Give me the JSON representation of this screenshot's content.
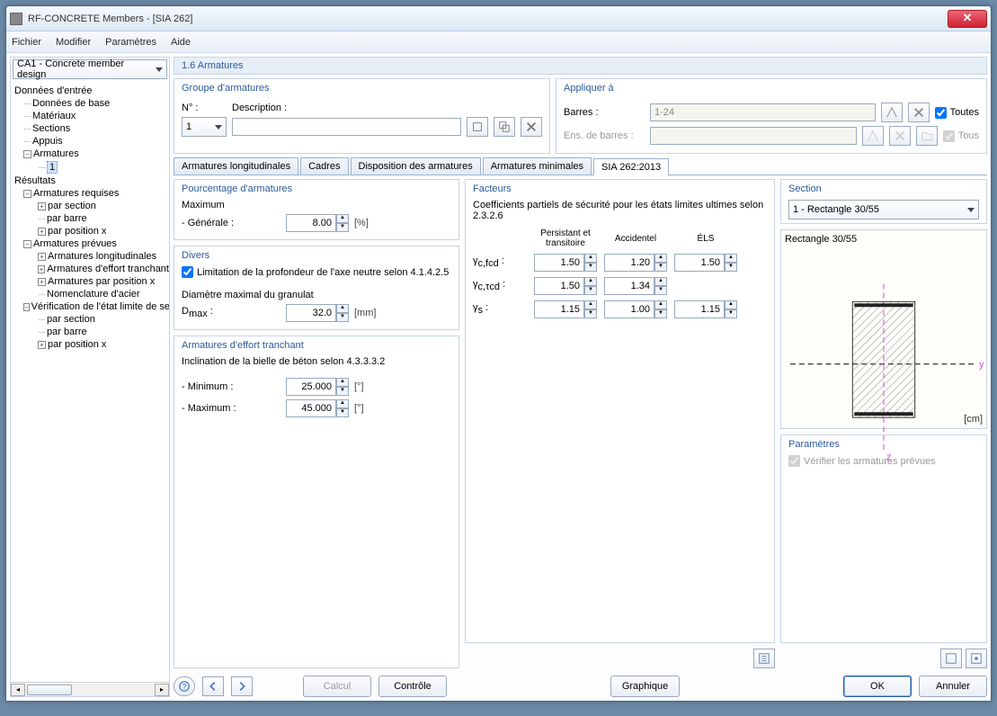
{
  "window": {
    "title": "RF-CONCRETE Members - [SIA 262]"
  },
  "menu": {
    "file": "Fichier",
    "edit": "Modifier",
    "params": "Paramètres",
    "help": "Aide"
  },
  "case_combo": "CA1 - Concrete member design",
  "tree": {
    "donnees_entree": "Données d'entrée",
    "donnees_base": "Données de base",
    "materiaux": "Matériaux",
    "sections": "Sections",
    "appuis": "Appuis",
    "armatures": "Armatures",
    "armatures_1": "1",
    "resultats": "Résultats",
    "arm_req": "Armatures requises",
    "par_section": "par section",
    "par_barre": "par barre",
    "par_position_x": "par position x",
    "arm_prev": "Armatures prévues",
    "arm_long": "Armatures longitudinales",
    "arm_effort": "Armatures d'effort tranchant",
    "arm_pos_x": "Armatures par position x",
    "nomenclature": "Nomenclature d'acier",
    "verif": "Vérification de l'état limite de se",
    "par_section2": "par section",
    "par_barre2": "par barre",
    "par_position_x2": "par position x"
  },
  "page_title": "1.6 Armatures",
  "groupe": {
    "title": "Groupe d'armatures",
    "no_label": "N° :",
    "no_value": "1",
    "desc_label": "Description :",
    "desc_value": ""
  },
  "appliquer": {
    "title": "Appliquer à",
    "barres_label": "Barres :",
    "barres_value": "1-24",
    "ens_label": "Ens. de barres :",
    "toutes": "Toutes",
    "tous": "Tous"
  },
  "tabs": {
    "t1": "Armatures longitudinales",
    "t2": "Cadres",
    "t3": "Disposition des armatures",
    "t4": "Armatures minimales",
    "t5": "SIA 262:2013"
  },
  "pourcentage": {
    "title": "Pourcentage d'armatures",
    "max_label": "Maximum",
    "generale_label": "- Générale :",
    "generale_value": "8.00",
    "generale_unit": "[%]"
  },
  "divers": {
    "title": "Divers",
    "limit_label": "Limitation de la profondeur de l'axe neutre selon 4.1.4.2.5",
    "diam_label": "Diamètre maximal du granulat",
    "dmax_label": "Dmax :",
    "dmax_value": "32.0",
    "dmax_unit": "[mm]"
  },
  "effort": {
    "title": "Armatures d'effort tranchant",
    "incl_label": "Inclination de la bielle de béton selon 4.3.3.3.2",
    "min_label": "- Minimum :",
    "min_value": "25.000",
    "max_label": "- Maximum :",
    "max_value": "45.000",
    "unit": "[°]"
  },
  "facteurs": {
    "title": "Facteurs",
    "desc": "Coefficients partiels de sécurité pour les états limites ultimes selon 2.3.2.6",
    "col1": "Persistant et transitoire",
    "col2": "Accidentel",
    "col3": "ÉLS",
    "r1l": "γc,fcd :",
    "r1v1": "1.50",
    "r1v2": "1.20",
    "r1v3": "1.50",
    "r2l": "γc,τcd :",
    "r2v1": "1.50",
    "r2v2": "1.34",
    "r3l": "γs :",
    "r3v1": "1.15",
    "r3v2": "1.00",
    "r3v3": "1.15"
  },
  "section": {
    "title": "Section",
    "combo": "1 - Rectangle 30/55",
    "name": "Rectangle 30/55",
    "unit": "[cm]",
    "y": "y",
    "z": "z"
  },
  "params": {
    "title": "Paramètres",
    "verify": "Vérifier les armatures prévues"
  },
  "buttons": {
    "calcul": "Calcul",
    "controle": "Contrôle",
    "graphique": "Graphique",
    "ok": "OK",
    "annuler": "Annuler"
  }
}
